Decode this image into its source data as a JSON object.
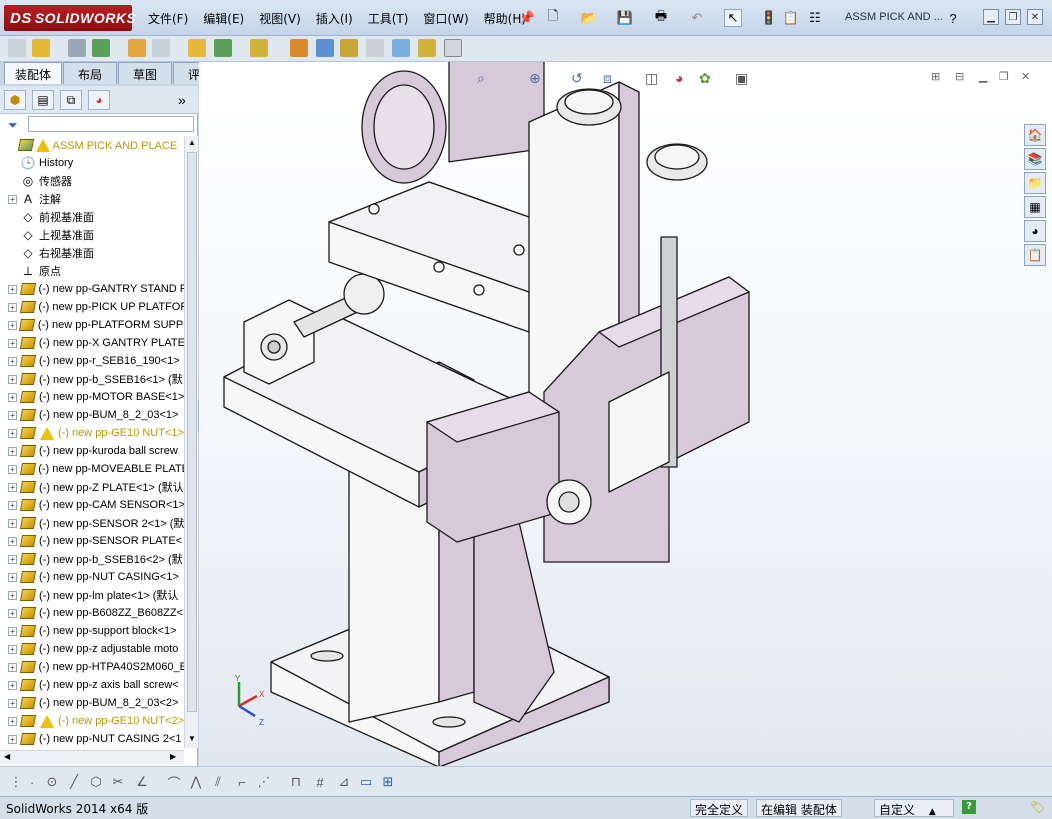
{
  "app": {
    "logo_prefix": "DS",
    "logo_text": "SOLIDWORKS"
  },
  "menu": [
    "文件(F)",
    "编辑(E)",
    "视图(V)",
    "插入(I)",
    "工具(T)",
    "窗口(W)",
    "帮助(H)"
  ],
  "document_title": "ASSM PICK AND ...",
  "cm_tabs": [
    {
      "label": "装配体",
      "active": true
    },
    {
      "label": "布局",
      "active": false
    },
    {
      "label": "草图",
      "active": false
    },
    {
      "label": "评估",
      "active": false
    }
  ],
  "tree": {
    "root": "ASSM PICK AND PLACE（默认",
    "items": [
      {
        "label": "History",
        "icon": "history-icon",
        "expandable": false
      },
      {
        "label": "传感器",
        "icon": "sensor-icon",
        "expandable": false
      },
      {
        "label": "注解",
        "icon": "annotation-icon",
        "expandable": true
      },
      {
        "label": "前视基准面",
        "icon": "plane-icon",
        "expandable": false
      },
      {
        "label": "上视基准面",
        "icon": "plane-icon",
        "expandable": false
      },
      {
        "label": "右视基准面",
        "icon": "plane-icon",
        "expandable": false
      },
      {
        "label": "原点",
        "icon": "origin-icon",
        "expandable": false
      },
      {
        "label": "(-) new pp-GANTRY STAND P",
        "icon": "part-icon",
        "expandable": true
      },
      {
        "label": "(-) new pp-PICK UP PLATFOR",
        "icon": "part-icon",
        "expandable": true
      },
      {
        "label": "(-) new pp-PLATFORM SUPPC",
        "icon": "part-icon",
        "expandable": true
      },
      {
        "label": "(-) new pp-X GANTRY PLATE",
        "icon": "part-icon",
        "expandable": true
      },
      {
        "label": "(-) new pp-r_SEB16_190<1>",
        "icon": "part-icon",
        "expandable": true
      },
      {
        "label": "(-) new pp-b_SSEB16<1> (默",
        "icon": "part-icon",
        "expandable": true
      },
      {
        "label": "(-) new pp-MOTOR BASE<1>",
        "icon": "part-icon",
        "expandable": true
      },
      {
        "label": "(-) new pp-BUM_8_2_03<1>",
        "icon": "part-icon",
        "expandable": true
      },
      {
        "label": "(-) new pp-GE10 NUT<1>",
        "icon": "part-icon",
        "expandable": true,
        "warning": true
      },
      {
        "label": "(-) new pp-kuroda ball screw",
        "icon": "part-icon",
        "expandable": true
      },
      {
        "label": "(-) new pp-MOVEABLE PLATE",
        "icon": "part-icon",
        "expandable": true
      },
      {
        "label": "(-) new pp-Z PLATE<1> (默认",
        "icon": "part-icon",
        "expandable": true
      },
      {
        "label": "(-) new pp-CAM SENSOR<1>",
        "icon": "part-icon",
        "expandable": true
      },
      {
        "label": "(-) new pp-SENSOR 2<1> (默",
        "icon": "part-icon",
        "expandable": true
      },
      {
        "label": "(-) new pp-SENSOR PLATE<",
        "icon": "part-icon",
        "expandable": true
      },
      {
        "label": "(-) new pp-b_SSEB16<2> (默",
        "icon": "part-icon",
        "expandable": true
      },
      {
        "label": "(-) new pp-NUT CASING<1>",
        "icon": "part-icon",
        "expandable": true
      },
      {
        "label": "(-) new pp-lm plate<1> (默认",
        "icon": "part-icon",
        "expandable": true
      },
      {
        "label": "(-) new pp-B608ZZ_B608ZZ<",
        "icon": "part-icon",
        "expandable": true
      },
      {
        "label": "(-) new pp-support block<1>",
        "icon": "part-icon",
        "expandable": true
      },
      {
        "label": "(-) new pp-z adjustable moto",
        "icon": "part-icon",
        "expandable": true
      },
      {
        "label": "(-) new pp-HTPA40S2M060_E",
        "icon": "part-icon",
        "expandable": true
      },
      {
        "label": "(-) new pp-z axis ball screw<",
        "icon": "part-icon",
        "expandable": true
      },
      {
        "label": "(-) new pp-BUM_8_2_03<2>",
        "icon": "part-icon",
        "expandable": true
      },
      {
        "label": "(-) new pp-GE10 NUT<2>",
        "icon": "part-icon",
        "expandable": true,
        "warning": true
      },
      {
        "label": "(-) new pp-NUT CASING 2<1",
        "icon": "part-icon",
        "expandable": true
      }
    ]
  },
  "triad": {
    "x": "X",
    "y": "Y",
    "z": "Z"
  },
  "status": {
    "product": "SolidWorks 2014 x64 版",
    "fully_defined": "完全定义",
    "editing": "在编辑 装配体",
    "units": "自定义"
  },
  "colors": {
    "part_lavender": "#d8c9da",
    "part_white": "#f7f7f7",
    "edge": "#1a1a1a",
    "accent_red": "#b81f24"
  }
}
